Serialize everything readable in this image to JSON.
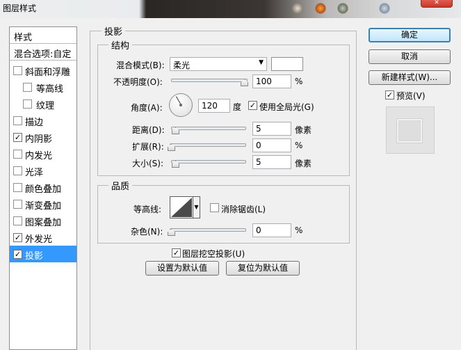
{
  "window": {
    "title": "图层样式",
    "close_glyph": "✕",
    "title_deco_icons": [
      "app-icon",
      "app-icon",
      "app-icon",
      "app-icon"
    ]
  },
  "style_list": {
    "header": "样式",
    "blending": "混合选项:自定",
    "items": [
      {
        "label": "斜面和浮雕",
        "checked": false
      },
      {
        "label": "等高线",
        "checked": false
      },
      {
        "label": "纹理",
        "checked": false
      },
      {
        "label": "描边",
        "checked": false
      },
      {
        "label": "内阴影",
        "checked": true
      },
      {
        "label": "内发光",
        "checked": false
      },
      {
        "label": "光泽",
        "checked": false
      },
      {
        "label": "颜色叠加",
        "checked": false
      },
      {
        "label": "渐变叠加",
        "checked": false
      },
      {
        "label": "图案叠加",
        "checked": false
      },
      {
        "label": "外发光",
        "checked": true
      },
      {
        "label": "投影",
        "checked": true,
        "selected": true
      }
    ],
    "check_glyph": "✓"
  },
  "drop_shadow": {
    "section_title": "投影",
    "structure": {
      "legend": "结构",
      "blend_mode_label": "混合模式(B):",
      "blend_mode_value": "柔光",
      "blend_color": "#ffffff",
      "opacity_label": "不透明度(O):",
      "opacity_value": "100",
      "opacity_unit": "%",
      "angle_label": "角度(A):",
      "angle_value": "120",
      "angle_unit": "度",
      "global_light_label": "使用全局光(G)",
      "global_light_checked": true,
      "distance_label": "距离(D):",
      "distance_value": "5",
      "distance_unit": "像素",
      "spread_label": "扩展(R):",
      "spread_value": "0",
      "spread_unit": "%",
      "size_label": "大小(S):",
      "size_value": "5",
      "size_unit": "像素"
    },
    "quality": {
      "legend": "品质",
      "contour_label": "等高线:",
      "antialias_label": "消除锯齿(L)",
      "antialias_checked": false,
      "noise_label": "杂色(N):",
      "noise_value": "0",
      "noise_unit": "%"
    },
    "knockout_label": "图层挖空投影(U)",
    "knockout_checked": true,
    "set_default_label": "设置为默认值",
    "reset_default_label": "复位为默认值"
  },
  "actions": {
    "ok_label": "确定",
    "cancel_label": "取消",
    "new_style_label": "新建样式(W)...",
    "preview_label": "预览(V)",
    "preview_checked": true
  },
  "colors": {
    "selection": "#3399ff",
    "default_button_border": "#3c7fb1"
  }
}
